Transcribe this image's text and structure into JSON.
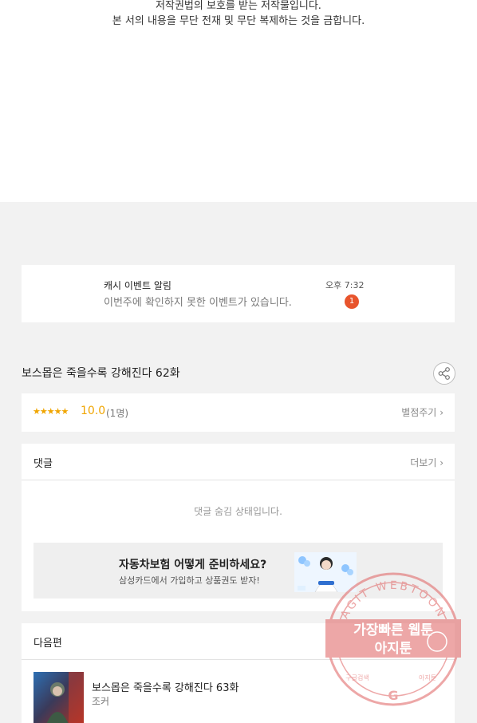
{
  "notice": {
    "line1": "저작권법의 보호를 받는 저작물입니다.",
    "line2": "본 서의 내용을 무단 전재 및 무단 복제하는 것을 금합니다."
  },
  "alarm": {
    "title": "캐시 이벤트 알림",
    "message": "이번주에 확인하지 못한 이벤트가 있습니다.",
    "time": "오후 7:32",
    "badge": "1"
  },
  "episode": {
    "title": "보스몹은 죽을수록 강해진다 62화",
    "share_icon": "share-icon"
  },
  "rating": {
    "stars": "★★★★★",
    "score": "10.0",
    "count": "(1명)",
    "rate_label": "별점주기"
  },
  "comments": {
    "label": "댓글",
    "more_label": "더보기",
    "hidden_message": "댓글 숨김 상태입니다."
  },
  "ad": {
    "title": "자동차보험 어떻게 준비하세요?",
    "subtitle": "삼성카드에서 가입하고 상품권도 받자!"
  },
  "next": {
    "label": "다음편",
    "episode_title": "보스몹은 죽을수록 강해진다 63화",
    "author": "조커"
  },
  "watermark": {
    "ring_text": "AGIT WEBTOON",
    "line1": "가장빠른 웹툰",
    "line2": "아지툰",
    "bottom_left": "구글검색",
    "bottom_right": "아지툰"
  },
  "colors": {
    "accent_star": "#f0a500",
    "badge": "#e8542c",
    "watermark": "#e06060"
  }
}
